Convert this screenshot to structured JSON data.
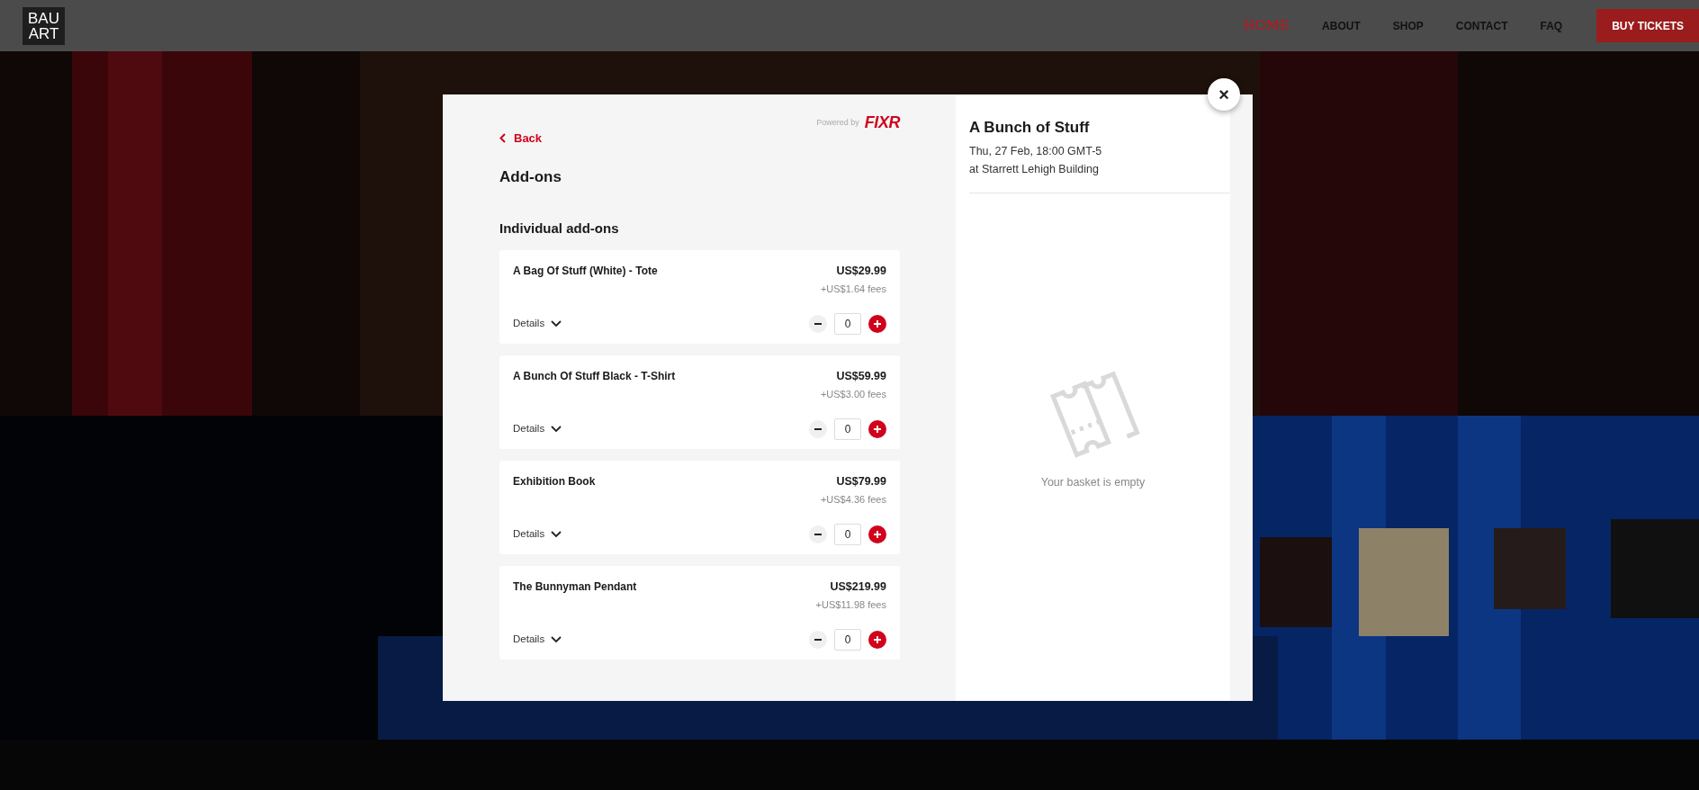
{
  "header": {
    "logo": [
      "BAU",
      "ART"
    ],
    "nav": [
      {
        "label": "HOME",
        "selected": true,
        "kind": "link"
      },
      {
        "label": "ABOUT",
        "selected": false,
        "kind": "link"
      },
      {
        "label": "SHOP",
        "selected": false,
        "kind": "link"
      },
      {
        "label": "CONTACT",
        "selected": false,
        "kind": "link"
      },
      {
        "label": "FAQ",
        "selected": false,
        "kind": "link"
      },
      {
        "label": "BUY TICKETS",
        "selected": false,
        "kind": "button"
      }
    ]
  },
  "modal": {
    "back": "Back",
    "powered_by": "Powered by",
    "brand": "FIXR",
    "title": "Add-ons",
    "section": "Individual add-ons",
    "items": [
      {
        "name": "A Bag Of Stuff (White) - Tote",
        "price": "US$29.99",
        "fees": "+US$1.64 fees",
        "details": "Details",
        "expanded": false,
        "quantity": "0"
      },
      {
        "name": "A Bunch Of Stuff Black - T-Shirt",
        "price": "US$59.99",
        "fees": "+US$3.00 fees",
        "details": "Details",
        "expanded": false,
        "quantity": "0"
      },
      {
        "name": "Exhibition Book",
        "price": "US$79.99",
        "fees": "+US$4.36 fees",
        "details": "Details",
        "expanded": false,
        "quantity": "0"
      },
      {
        "name": "The Bunnyman Pendant",
        "price": "US$219.99",
        "fees": "+US$11.98 fees",
        "details": "Details",
        "expanded": false,
        "quantity": "0"
      }
    ],
    "event": {
      "title": "A Bunch of Stuff",
      "date": "Thu, 27 Feb, 18:00 GMT-5",
      "venue": "at Starrett Lehigh Building"
    },
    "basket": {
      "empty_text": "Your basket is empty"
    },
    "close": "×"
  }
}
